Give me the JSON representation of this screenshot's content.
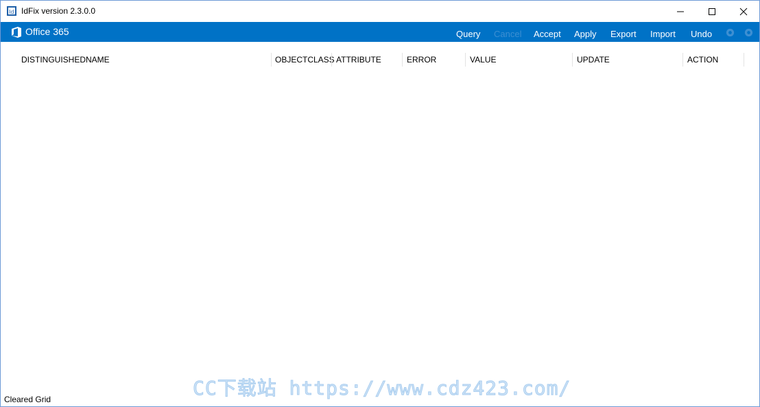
{
  "window": {
    "title": "IdFix version 2.3.0.0"
  },
  "ribbon": {
    "brand": "Office 365",
    "menu": {
      "query": "Query",
      "cancel": "Cancel",
      "accept": "Accept",
      "apply": "Apply",
      "export": "Export",
      "import": "Import",
      "undo": "Undo"
    },
    "icons": [
      "gear-icon",
      "settings-icon"
    ]
  },
  "grid": {
    "columns": [
      "DISTINGUISHEDNAME",
      "OBJECTCLASS",
      "ATTRIBUTE",
      "ERROR",
      "VALUE",
      "UPDATE",
      "ACTION"
    ],
    "rows": []
  },
  "status": {
    "text": "Cleared Grid"
  },
  "watermark": {
    "text": "CC下载站 https://www.cdz423.com/"
  },
  "colors": {
    "ribbon": "#0072c6",
    "window_border": "#6d9ad6"
  }
}
